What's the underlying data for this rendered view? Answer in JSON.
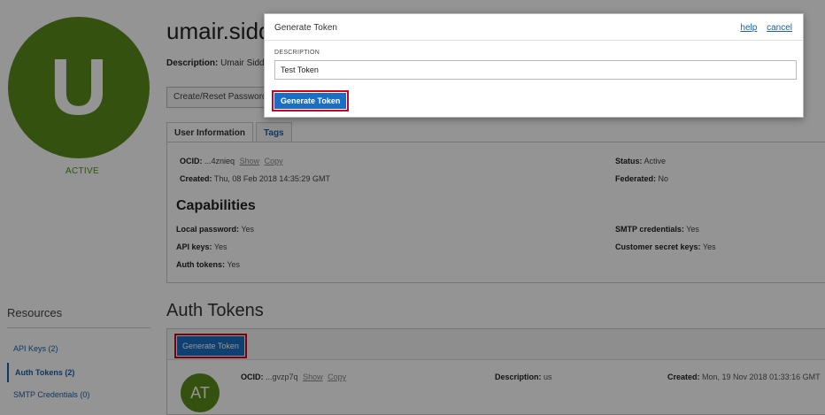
{
  "user": {
    "initial": "U",
    "name": "umair.siddiqu",
    "status": "ACTIVE",
    "description_label": "Description:",
    "description_value": "Umair Siddiqu"
  },
  "actions": {
    "create_reset_password": "Create/Reset Password"
  },
  "tabs": [
    {
      "label": "User Information"
    },
    {
      "label": "Tags"
    }
  ],
  "user_info": {
    "ocid_label": "OCID:",
    "ocid_value": "...4znieq",
    "show": "Show",
    "copy": "Copy",
    "created_label": "Created:",
    "created_value": "Thu, 08 Feb 2018 14:35:29 GMT",
    "status_label": "Status:",
    "status_value": "Active",
    "federated_label": "Federated:",
    "federated_value": "No"
  },
  "capabilities": {
    "title": "Capabilities",
    "local_password_label": "Local password:",
    "local_password_value": "Yes",
    "api_keys_label": "API keys:",
    "api_keys_value": "Yes",
    "auth_tokens_label": "Auth tokens:",
    "auth_tokens_value": "Yes",
    "smtp_label": "SMTP credentials:",
    "smtp_value": "Yes",
    "customer_secret_label": "Customer secret keys:",
    "customer_secret_value": "Yes"
  },
  "resources": {
    "title": "Resources",
    "items": [
      {
        "label": "API Keys (2)"
      },
      {
        "label": "Auth Tokens (2)"
      },
      {
        "label": "SMTP Credentials (0)"
      }
    ]
  },
  "auth_tokens": {
    "title": "Auth Tokens",
    "generate_button": "Generate Token",
    "row": {
      "avatar": "AT",
      "ocid_label": "OCID:",
      "ocid_value": "...gvzp7q",
      "show": "Show",
      "copy": "Copy",
      "description_label": "Description:",
      "description_value": "us",
      "created_label": "Created:",
      "created_value": "Mon, 19 Nov 2018 01:33:16 GMT"
    }
  },
  "dialog": {
    "title": "Generate Token",
    "help": "help",
    "cancel": "cancel",
    "field_label": "DESCRIPTION",
    "field_value": "Test Token",
    "submit": "Generate Token"
  },
  "colors": {
    "brand_green": "#5a8c1a",
    "link_blue": "#1a5fa8",
    "button_blue": "#1a6fc4",
    "highlight_red": "#d0021b"
  }
}
